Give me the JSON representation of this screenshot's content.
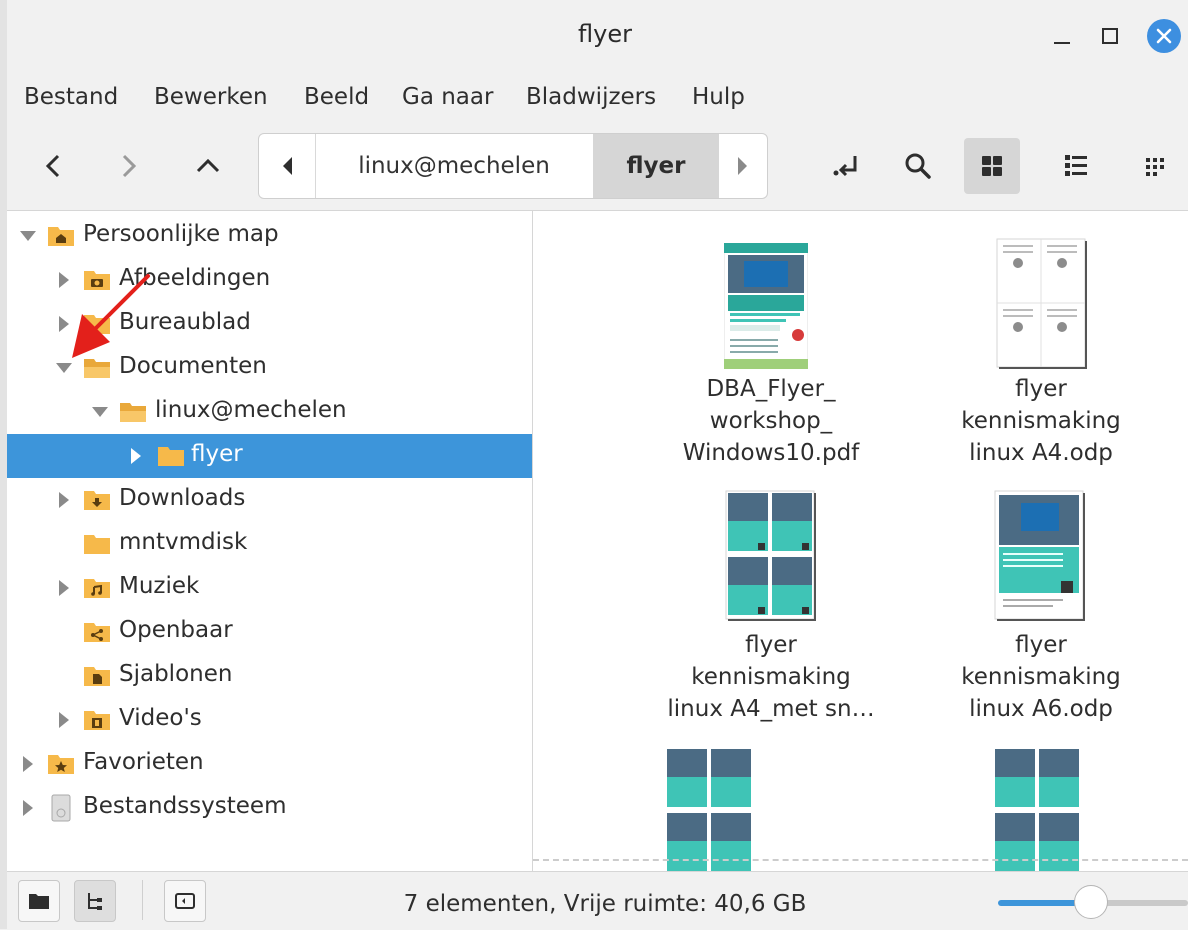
{
  "window": {
    "title": "flyer"
  },
  "menu": {
    "items": [
      "Bestand",
      "Bewerken",
      "Beeld",
      "Ga naar",
      "Bladwijzers",
      "Hulp"
    ]
  },
  "breadcrumbs": [
    "linux@mechelen",
    "flyer"
  ],
  "sidebar": {
    "items": [
      {
        "label": "Persoonlijke map",
        "icon": "home-folder-icon",
        "expander": "expanded"
      },
      {
        "label": "Afbeeldingen",
        "icon": "camera-folder-icon",
        "expander": "collapsed"
      },
      {
        "label": "Bureaublad",
        "icon": "folder-icon",
        "expander": "collapsed"
      },
      {
        "label": "Documenten",
        "icon": "folder-open-icon",
        "expander": "expanded"
      },
      {
        "label": "linux@mechelen",
        "icon": "folder-open-icon",
        "expander": "expanded"
      },
      {
        "label": "flyer",
        "icon": "folder-icon",
        "expander": "collapsed",
        "selected": true
      },
      {
        "label": "Downloads",
        "icon": "download-folder-icon",
        "expander": "collapsed"
      },
      {
        "label": "mntvmdisk",
        "icon": "folder-icon",
        "expander": "none"
      },
      {
        "label": "Muziek",
        "icon": "music-folder-icon",
        "expander": "collapsed"
      },
      {
        "label": "Openbaar",
        "icon": "share-folder-icon",
        "expander": "none"
      },
      {
        "label": "Sjablonen",
        "icon": "template-folder-icon",
        "expander": "none"
      },
      {
        "label": "Video's",
        "icon": "video-folder-icon",
        "expander": "collapsed"
      },
      {
        "label": "Favorieten",
        "icon": "star-folder-icon",
        "expander": "collapsed"
      },
      {
        "label": "Bestandssysteem",
        "icon": "drive-icon",
        "expander": "collapsed"
      }
    ]
  },
  "files": [
    {
      "lines": [
        "DBA_Flyer_",
        "workshop_",
        "Windows10.pdf"
      ]
    },
    {
      "lines": [
        "flyer",
        "kennismaking",
        "linux A4.odp"
      ]
    },
    {
      "lines": [
        "flyer",
        "kennismaking",
        "linux A4_met sn…"
      ]
    },
    {
      "lines": [
        "flyer",
        "kennismaking",
        "linux A6.odp"
      ]
    }
  ],
  "status": {
    "text": "7 elementen, Vrije ruimte: 40,6 GB",
    "zoom_fraction": 0.45
  },
  "colors": {
    "selection": "#3d95da",
    "folder": "#f6b94a",
    "close": "#3d8fe0",
    "teal": "#3fc4b6",
    "annotation_arrow": "#e3201b"
  }
}
